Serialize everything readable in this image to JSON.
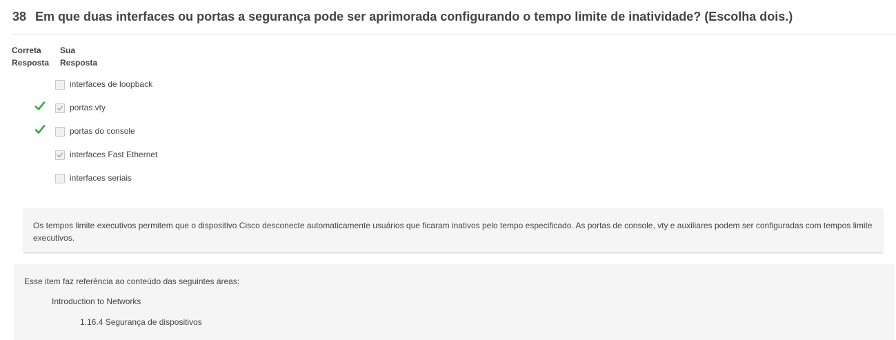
{
  "question": {
    "number": "38",
    "text": "Em que duas interfaces ou portas a segurança pode ser aprimorada configurando o tempo limite de inatividade? (Escolha dois.)"
  },
  "columns": {
    "correct_line1": "Correta",
    "correct_line2": "Resposta",
    "yours_line1": "Sua",
    "yours_line2": "Resposta"
  },
  "options": [
    {
      "label": "interfaces de loopback",
      "correct": false,
      "selected": false
    },
    {
      "label": "portas vty",
      "correct": true,
      "selected": true
    },
    {
      "label": "portas do console",
      "correct": true,
      "selected": false
    },
    {
      "label": "interfaces Fast Ethernet",
      "correct": false,
      "selected": true
    },
    {
      "label": "interfaces seriais",
      "correct": false,
      "selected": false
    }
  ],
  "feedback": {
    "text": "Os tempos limite executivos permitem que o dispositivo Cisco desconecte automaticamente usuários que ficaram inativos pelo tempo especificado. As portas de console, vty e auxiliares podem ser configuradas com tempos limite executivos."
  },
  "reference": {
    "intro": "Esse item faz referência ao conteúdo das seguintes áreas:",
    "course": "Introduction to Networks",
    "section": "1.16.4 Segurança de dispositivos"
  },
  "colors": {
    "correct_check": "#2eaa3a",
    "panel_bg": "#f5f5f5",
    "text": "#444444"
  }
}
